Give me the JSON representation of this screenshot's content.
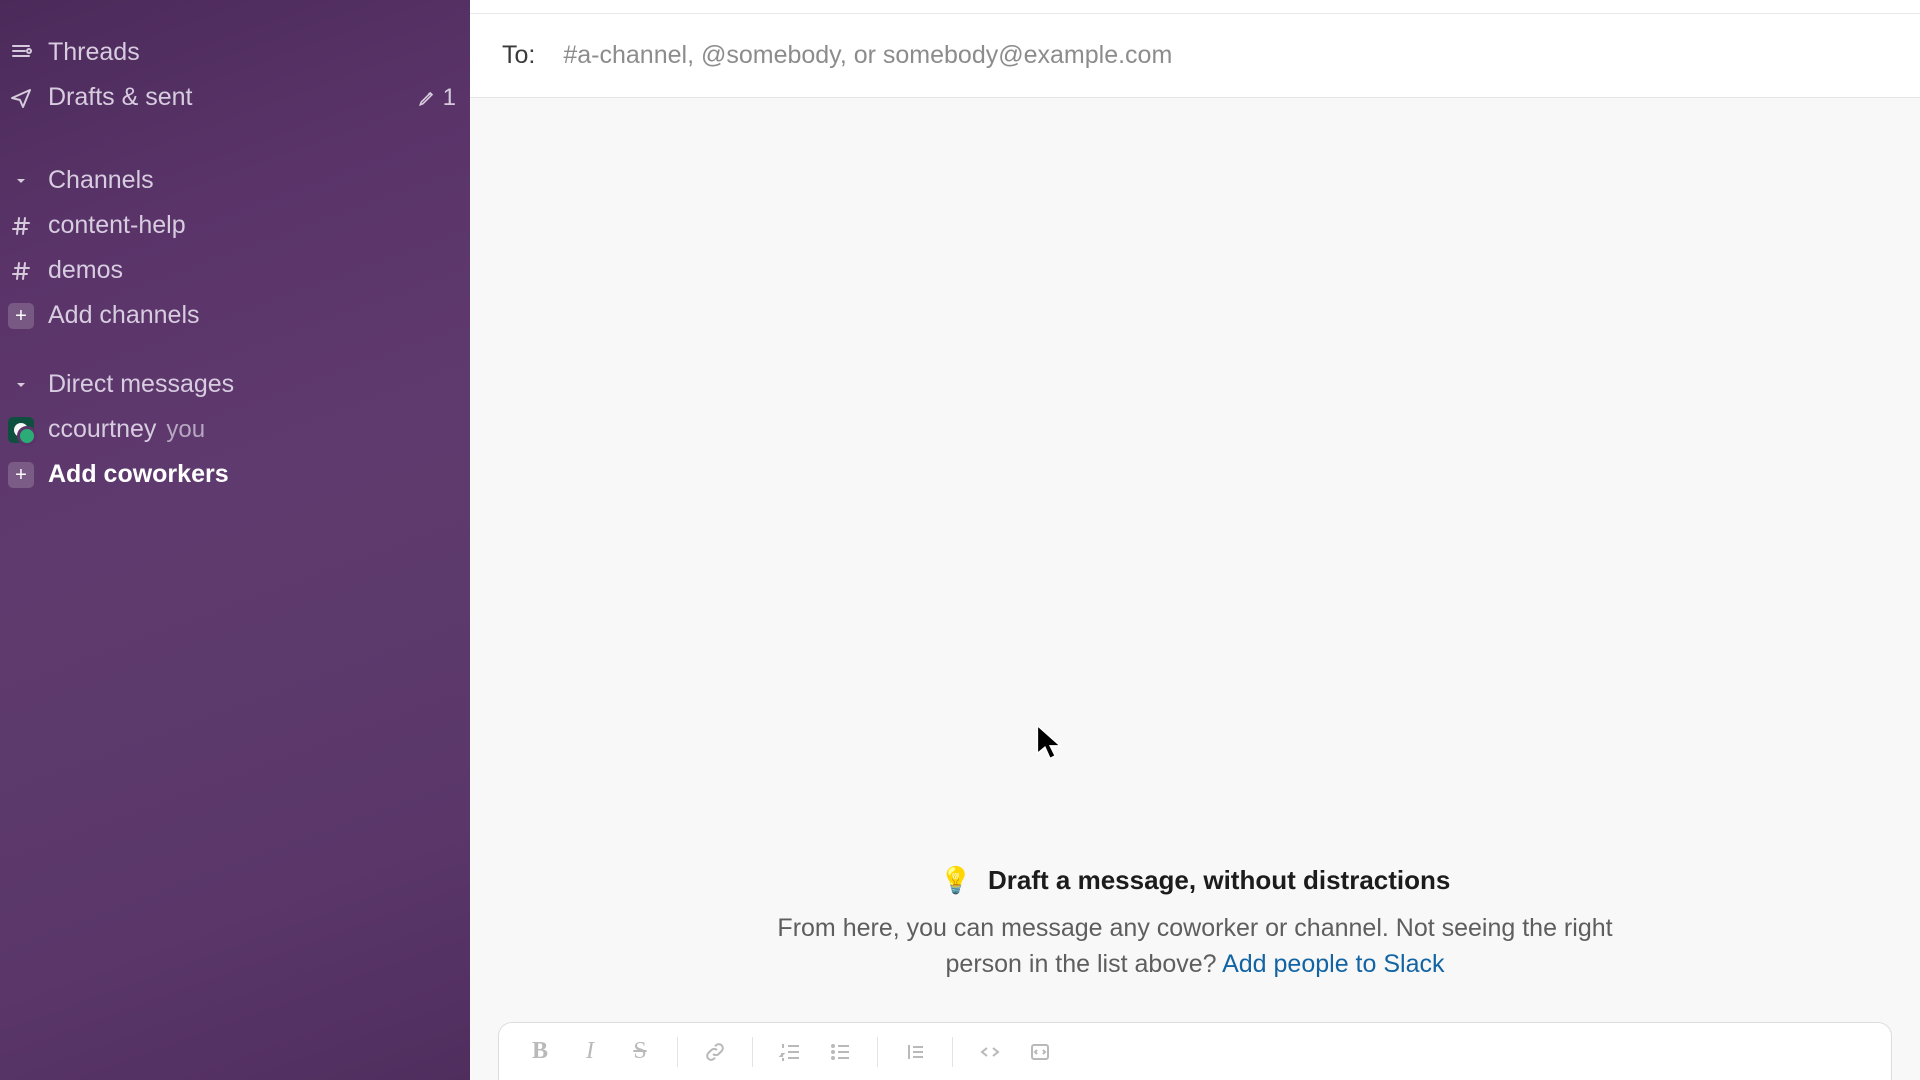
{
  "sidebar": {
    "threads": "Threads",
    "drafts": "Drafts & sent",
    "drafts_count": "1",
    "channels_header": "Channels",
    "channels": [
      {
        "name": "content-help"
      },
      {
        "name": "demos"
      }
    ],
    "add_channels": "Add channels",
    "dms_header": "Direct messages",
    "self_dm_name": "ccourtney",
    "self_dm_you": "you",
    "add_coworkers": "Add coworkers"
  },
  "compose": {
    "to_label": "To:",
    "to_placeholder": "#a-channel, @somebody, or somebody@example.com"
  },
  "empty": {
    "title": "Draft a message, without distractions",
    "body_before_link": "From here, you can message any coworker or channel. Not seeing the right person in the list above? ",
    "link": "Add people to Slack"
  },
  "toolbar": {
    "bold": "B",
    "italic": "I",
    "strike": "S"
  }
}
